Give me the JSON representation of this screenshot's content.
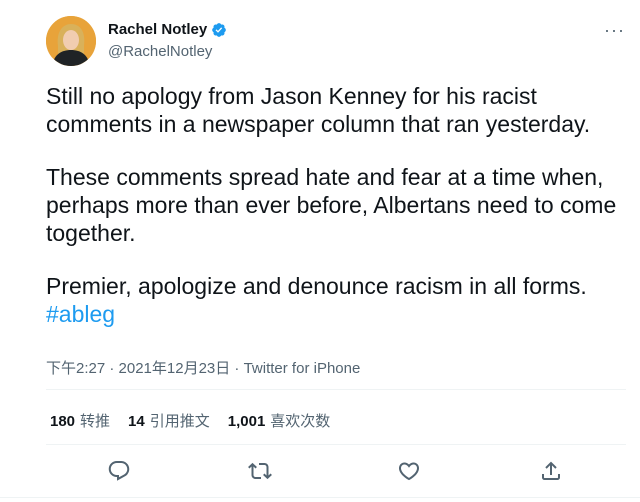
{
  "user": {
    "name": "Rachel Notley",
    "handle": "@RachelNotley"
  },
  "more_label": "···",
  "tweet": {
    "paragraphs": [
      "Still no apology from Jason Kenney for his racist comments in a newspaper column that ran yesterday.",
      "These comments spread hate and fear at a time when, perhaps more than ever before, Albertans need to come together."
    ],
    "last_text": "Premier, apologize and denounce racism in all forms.",
    "hashtag": "#ableg"
  },
  "meta": "下午2:27 · 2021年12月23日 · Twitter for iPhone",
  "stats": {
    "retweets_count": "180",
    "retweets_label": "转推",
    "quotes_count": "14",
    "quotes_label": "引用推文",
    "likes_count": "1,001",
    "likes_label": "喜欢次数"
  },
  "colors": {
    "accent": "#1d9bf0",
    "text": "#0f1419",
    "secondary": "#536471"
  },
  "icons": [
    "verified-badge-icon",
    "more-icon",
    "reply-icon",
    "retweet-icon",
    "like-icon",
    "share-icon"
  ]
}
